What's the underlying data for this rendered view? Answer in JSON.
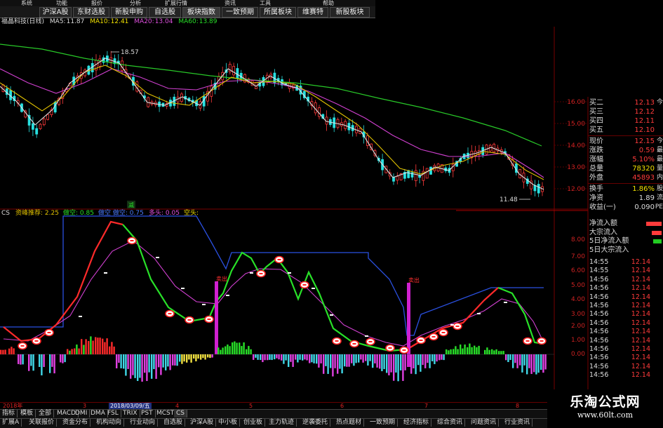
{
  "top_tabs": [
    "系统",
    "功能",
    "报价",
    "分析",
    "扩展行情",
    "资讯",
    "工具",
    "帮助"
  ],
  "nav": [
    "沪深A股",
    "东财选股",
    "新股申购",
    "自选股",
    "板块指数",
    "一致预期",
    "所属板块",
    "维赛特",
    "新股板块"
  ],
  "stock": {
    "name_line": "福晶科技(日线)",
    "ma5_label": "MA5:",
    "ma5": "11.87",
    "ma10_label": "MA10:",
    "ma10": "12.41",
    "ma20_label": "MA20:",
    "ma20": "13.04",
    "ma60_label": "MA60:",
    "ma60": "13.89",
    "high_marker": "18.57",
    "low_marker": "11.48"
  },
  "price_axis": [
    "16.00",
    "15.00",
    "14.00",
    "13.00",
    "12.00"
  ],
  "indicator": {
    "name": "CS",
    "l1": "资峰推荐: 2.25",
    "l2": "做空: 0.85",
    "l3": "做空 做空: 0.75",
    "l4": "多头: 0.05",
    "l5": "空头:",
    "tag_top": "减",
    "sell_label_1": "卖出",
    "sell_label_2": "卖出"
  },
  "indicator_axis": [
    "8.00",
    "7.00",
    "6.00",
    "5.00",
    "4.00",
    "3.00",
    "2.00",
    "1.00",
    "0.00"
  ],
  "quote": [
    {
      "label": "买二",
      "value": "12.13",
      "extra": "今"
    },
    {
      "label": "买三",
      "value": "12.12",
      "extra": ""
    },
    {
      "label": "买四",
      "value": "12.11",
      "extra": ""
    },
    {
      "label": "买五",
      "value": "12.10",
      "extra": ""
    },
    {
      "label": "现价",
      "value": "12.15",
      "extra": "今"
    },
    {
      "label": "涨跌",
      "value": "0.59",
      "extra": "最"
    },
    {
      "label": "涨幅",
      "value": "5.10%",
      "extra": "最"
    },
    {
      "label": "总量",
      "value": "78320",
      "extra": "量"
    },
    {
      "label": "外盘",
      "value": "45893",
      "extra": "内"
    },
    {
      "label": "换手",
      "value": "1.86%",
      "extra": "股"
    },
    {
      "label": "净资",
      "value": "1.89",
      "extra": "流"
    },
    {
      "label": "收益(一)",
      "value": "0.090",
      "extra": "PE"
    }
  ],
  "flow": [
    {
      "label": "净流入额",
      "color": "#ff3b3b"
    },
    {
      "label": "大宗流入",
      "color": "#ff3b3b"
    },
    {
      "label": "5日净流入额",
      "color": "#22cc22"
    },
    {
      "label": "5日大宗流入",
      "color": ""
    }
  ],
  "ticks": [
    {
      "time": "14:55",
      "price": "12.14"
    },
    {
      "time": "14:55",
      "price": "12.14"
    },
    {
      "time": "14:56",
      "price": "12.14"
    },
    {
      "time": "14:56",
      "price": "12.14"
    },
    {
      "time": "14:56",
      "price": "12.14"
    },
    {
      "time": "14:56",
      "price": "12.14"
    },
    {
      "time": "14:56",
      "price": "12.14"
    },
    {
      "time": "14:56",
      "price": "12.14"
    },
    {
      "time": "14:56",
      "price": "12.14"
    },
    {
      "time": "14:56",
      "price": "12.14"
    },
    {
      "time": "14:56",
      "price": "12.14"
    },
    {
      "time": "14:56",
      "price": "12.14"
    },
    {
      "time": "14:56",
      "price": "12.14"
    },
    {
      "time": "14:56",
      "price": "12.14"
    }
  ],
  "date_axis": {
    "year": "2018年",
    "m3": "3",
    "selected": "2018/03/09/五",
    "m4": "4",
    "m5": "5",
    "m6": "6",
    "m7": "7",
    "m8": "8"
  },
  "tabs_row1": [
    "指标",
    "模板",
    "全部",
    "MACD",
    "DMI",
    "DMA",
    "FSL",
    "TRIX",
    "PST",
    "MCST",
    "CS"
  ],
  "tabs_row2": [
    "扩展A",
    "关联报价",
    "资金分布",
    "机构动向",
    "行业动向",
    "自选股",
    "沪深A股",
    "中小板",
    "创业板",
    "主力轨迹",
    "逆袭委托",
    "热点题材",
    "一致预期",
    "经济指标",
    "综合资讯",
    "问题资讯",
    "行业资讯"
  ],
  "brand": {
    "title": "乐淘公式网",
    "url": "www.60lt.com"
  },
  "colors": {
    "up": "#ff3b3b",
    "down": "#28e028",
    "ma5": "#ffffff",
    "ma10": "#f0e000",
    "ma20": "#e050e0",
    "ma60": "#28c828"
  }
}
